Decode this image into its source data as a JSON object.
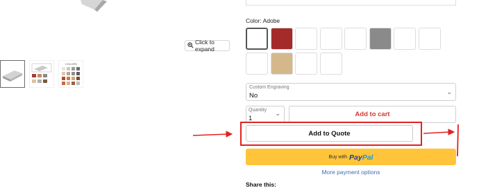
{
  "gallery": {
    "expand_label": "Click to expand",
    "thumb_text": "COLORS"
  },
  "product": {
    "color_label": "Color: Adobe",
    "swatches": [
      {
        "name": "white",
        "color": "#ffffff",
        "selected": true
      },
      {
        "name": "red",
        "color": "#a52a2a",
        "selected": false
      },
      {
        "name": "empty-1",
        "color": "#ffffff",
        "selected": false
      },
      {
        "name": "empty-2",
        "color": "#ffffff",
        "selected": false
      },
      {
        "name": "empty-3",
        "color": "#ffffff",
        "selected": false
      },
      {
        "name": "gray",
        "color": "#8a8a8a",
        "selected": false
      },
      {
        "name": "empty-4",
        "color": "#ffffff",
        "selected": false
      },
      {
        "name": "empty-5",
        "color": "#ffffff",
        "selected": false
      },
      {
        "name": "empty-6",
        "color": "#ffffff",
        "selected": false
      },
      {
        "name": "tan",
        "color": "#d4b88c",
        "selected": false
      },
      {
        "name": "empty-7",
        "color": "#ffffff",
        "selected": false
      },
      {
        "name": "empty-8",
        "color": "#ffffff",
        "selected": false
      }
    ],
    "engraving": {
      "label": "Custom Engraving",
      "value": "No"
    },
    "quantity": {
      "label": "Quantity",
      "value": "1"
    },
    "add_to_cart_label": "Add to cart",
    "add_to_quote_label": "Add to Quote",
    "paypal": {
      "buy_with": "Buy with",
      "brand_a": "Pay",
      "brand_b": "Pal"
    },
    "more_payment_label": "More payment options",
    "share_label": "Share this:"
  },
  "annotation_color": "#e02020"
}
